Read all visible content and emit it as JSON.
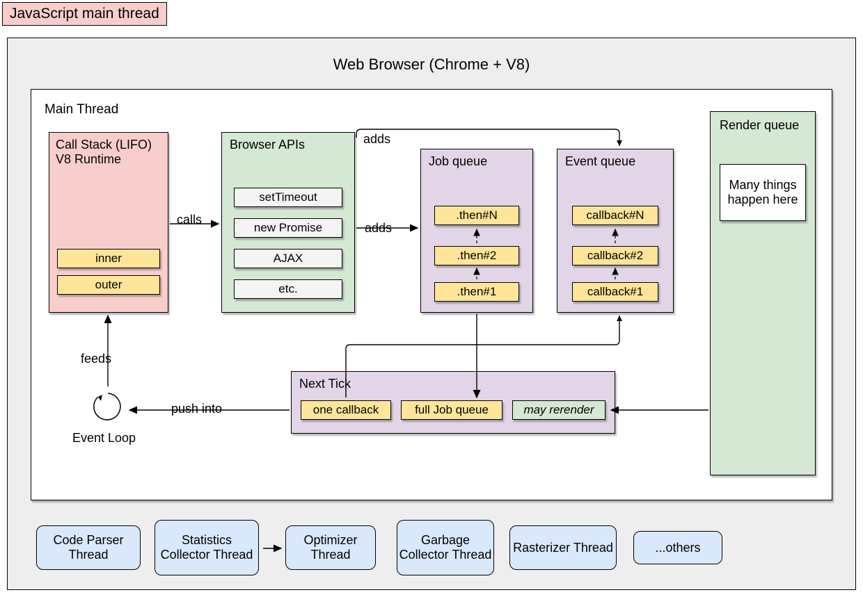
{
  "title_tag": "JavaScript main thread",
  "browser_title": "Web Browser (Chrome + V8)",
  "main_thread_label": "Main Thread",
  "call_stack": {
    "title": "Call Stack (LIFO)\nV8 Runtime",
    "items": [
      "inner",
      "outer"
    ]
  },
  "browser_apis": {
    "title": "Browser APIs",
    "items": [
      "setTimeout",
      "new Promise",
      "AJAX",
      "etc."
    ]
  },
  "job_queue": {
    "title": "Job queue",
    "items": [
      ".then#N",
      ".then#2",
      ".then#1"
    ]
  },
  "event_queue": {
    "title": "Event queue",
    "items": [
      "callback#N",
      "callback#2",
      "callback#1"
    ]
  },
  "render_queue": {
    "title": "Render queue",
    "note": "Many things happen here"
  },
  "next_tick": {
    "title": "Next Tick",
    "items": [
      "one callback",
      "full Job queue",
      "may rerender"
    ]
  },
  "event_loop_label": "Event Loop",
  "edges": {
    "calls": "calls",
    "adds1": "adds",
    "adds2": "adds",
    "feeds": "feeds",
    "push_into": "push into"
  },
  "threads": [
    "Code Parser Thread",
    "Statistics Collector Thread",
    "Optimizer Thread",
    "Garbage Collector Thread",
    "Rasterizer Thread",
    "...others"
  ]
}
